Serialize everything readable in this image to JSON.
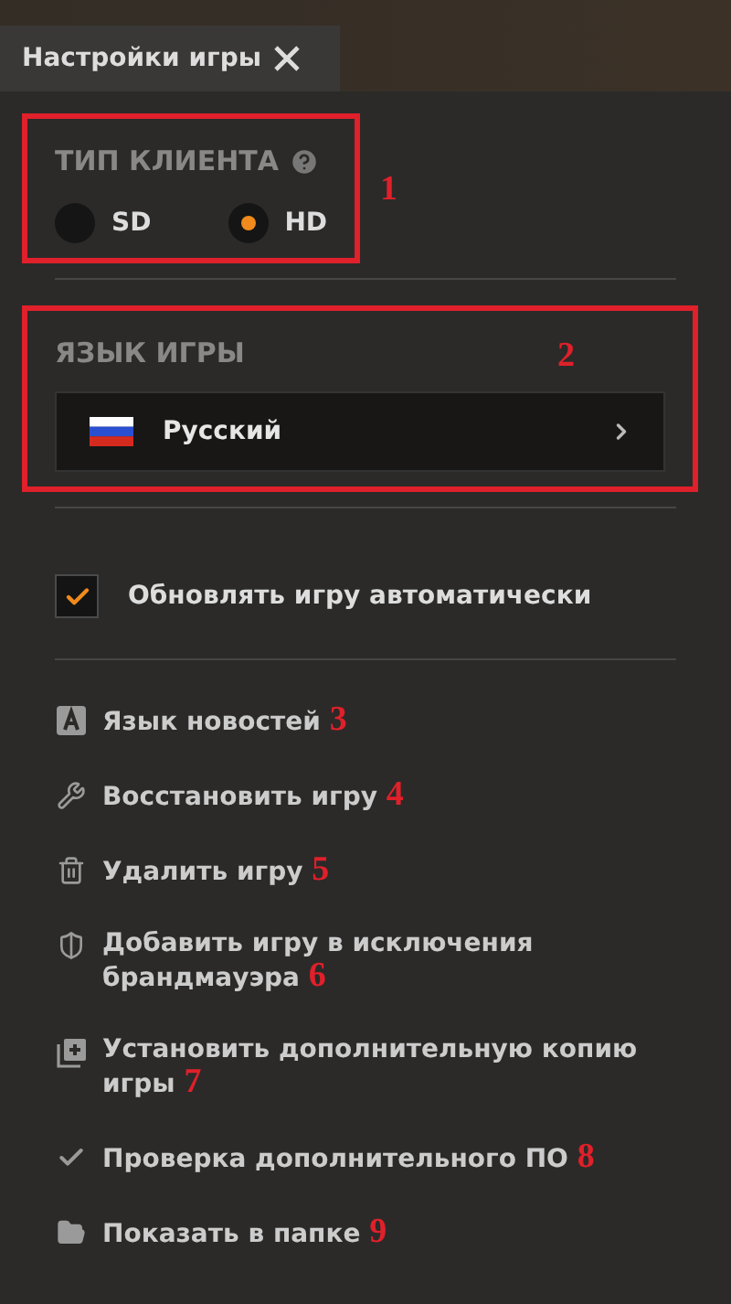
{
  "header": {
    "title": "Настройки игры"
  },
  "client_type": {
    "title": "ТИП КЛИЕНТА",
    "marker": "1",
    "options": [
      {
        "label": "SD",
        "selected": false
      },
      {
        "label": "HD",
        "selected": true
      }
    ]
  },
  "game_language": {
    "title": "ЯЗЫК ИГРЫ",
    "marker": "2",
    "value": "Русский"
  },
  "auto_update": {
    "label": "Обновлять игру автоматически",
    "checked": true
  },
  "actions": [
    {
      "kind": "letter",
      "label": "Язык новостей",
      "marker": "3"
    },
    {
      "kind": "wrench",
      "label": "Восстановить игру",
      "marker": "4"
    },
    {
      "kind": "trash",
      "label": "Удалить игру",
      "marker": "5"
    },
    {
      "kind": "shield",
      "label": "Добавить игру в исключения брандмауэра",
      "marker": "6"
    },
    {
      "kind": "copy",
      "label": "Установить дополнительную копию игры",
      "marker": "7"
    },
    {
      "kind": "check",
      "label": "Проверка дополнительного ПО",
      "marker": "8"
    },
    {
      "kind": "folder",
      "label": "Показать в папке",
      "marker": "9"
    }
  ]
}
